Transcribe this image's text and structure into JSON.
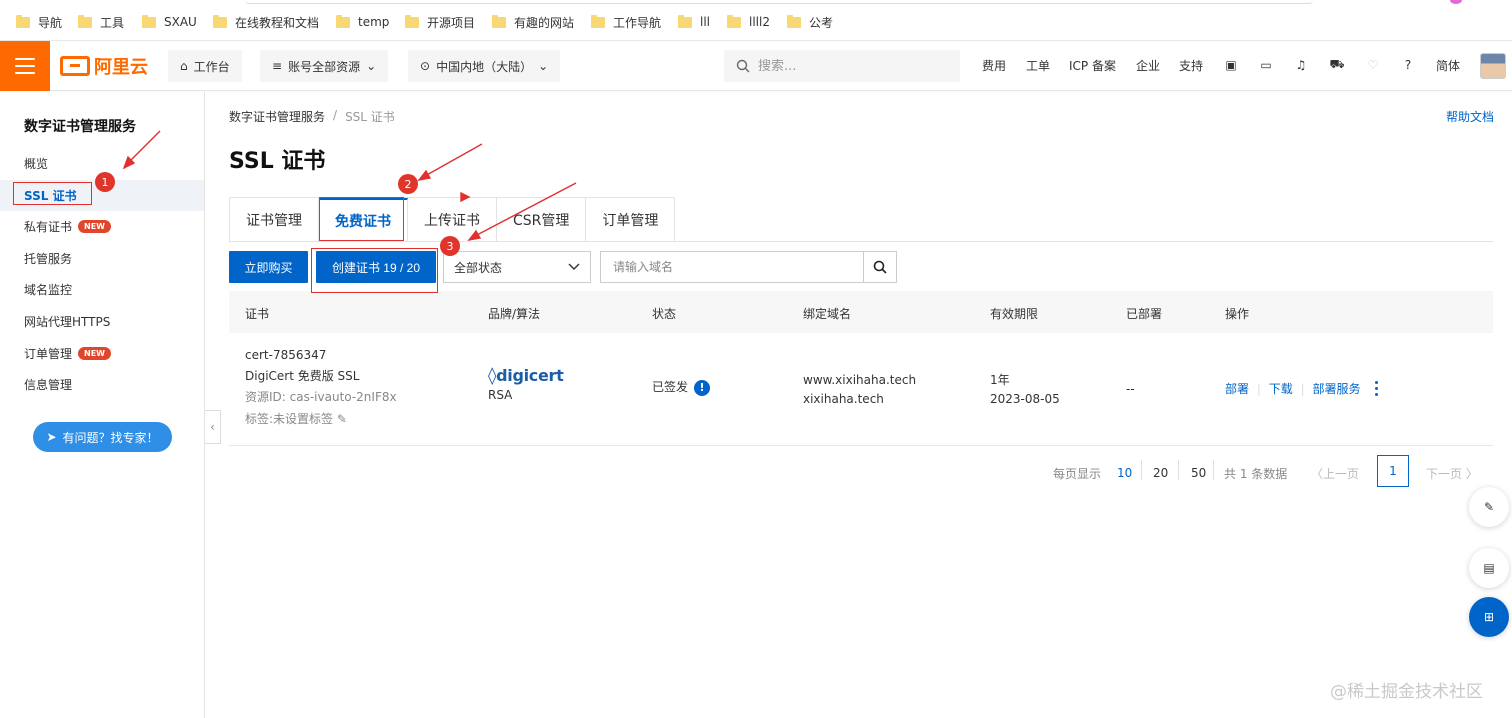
{
  "bookmarks": [
    "导航",
    "工具",
    "SXAU",
    "在线教程和文档",
    "temp",
    "开源项目",
    "有趣的网站",
    "工作导航",
    "lll",
    "llll2",
    "公考"
  ],
  "topnav": {
    "logo": "阿里云",
    "workbench": "工作台",
    "account_resources": "账号全部资源",
    "region": "中国内地（大陆）",
    "search_placeholder": "搜索...",
    "links": [
      "费用",
      "工单",
      "ICP 备案",
      "企业",
      "支持"
    ],
    "language": "简体",
    "accent_color": "#ff6a00"
  },
  "sidebar": {
    "title": "数字证书管理服务",
    "items": [
      {
        "label": "概览",
        "badge": ""
      },
      {
        "label": "SSL 证书",
        "badge": "",
        "active": true
      },
      {
        "label": "私有证书",
        "badge": "NEW"
      },
      {
        "label": "托管服务",
        "badge": ""
      },
      {
        "label": "域名监控",
        "badge": ""
      },
      {
        "label": "网站代理HTTPS",
        "badge": ""
      },
      {
        "label": "订单管理",
        "badge": "NEW"
      },
      {
        "label": "信息管理",
        "badge": ""
      }
    ],
    "help_button": "有问题？找专家！"
  },
  "main": {
    "breadcrumb": [
      "数字证书管理服务",
      "/",
      "SSL 证书"
    ],
    "help_docs": "帮助文档",
    "title": "SSL 证书",
    "tabs": [
      "证书管理",
      "免费证书",
      "上传证书",
      "CSR管理",
      "订单管理"
    ],
    "active_tab": 1,
    "buy_button": "立即购买",
    "create_button": "创建证书 19 / 20",
    "status_select": "全部状态",
    "domain_placeholder": "请输入域名",
    "brand_color": "#0064c8"
  },
  "table": {
    "headers": [
      "证书",
      "品牌/算法",
      "状态",
      "绑定域名",
      "有效期限",
      "已部署",
      "操作"
    ],
    "row": {
      "cert_id": "cert-7856347",
      "cert_name": "DigiCert 免费版 SSL",
      "resource_id": "资源ID: cas-ivauto-2nIF8x",
      "tag": "标签:未设置标签",
      "brand": "digicert",
      "algorithm": "RSA",
      "status": "已签发",
      "domain1": "www.xixihaha.tech",
      "domain2": "xixihaha.tech",
      "validity": "1年",
      "expiry": "2023-08-05",
      "deployed": "--",
      "actions": [
        "部署",
        "下载",
        "部署服务"
      ]
    }
  },
  "pagination": {
    "per_page_label": "每页显示",
    "sizes": [
      "10",
      "20",
      "50"
    ],
    "total": "共 1 条数据",
    "prev": "〈上一页",
    "current": "1",
    "next": "下一页 〉"
  },
  "annotations": [
    "1",
    "2",
    "3"
  ],
  "watermark": "@稀土掘金技术社区"
}
